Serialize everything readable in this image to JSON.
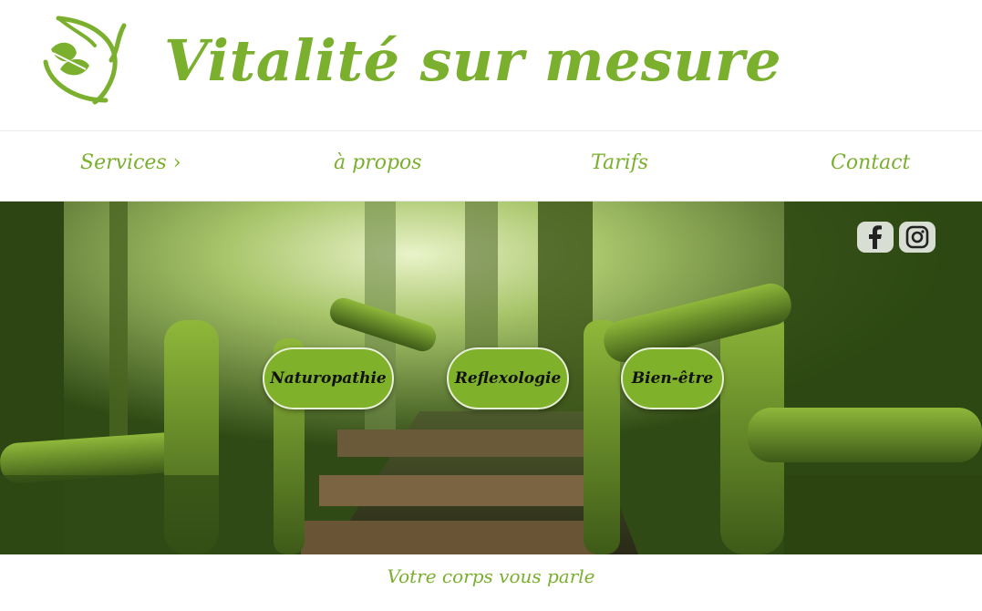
{
  "site": {
    "title": "Vitalité sur mesure",
    "brand_color": "#7ab02e"
  },
  "nav": {
    "items": [
      {
        "label": "Services",
        "has_submenu": true
      },
      {
        "label": "à propos"
      },
      {
        "label": "Tarifs"
      },
      {
        "label": "Contact"
      }
    ]
  },
  "social": {
    "icons": [
      "facebook-icon",
      "instagram-icon"
    ]
  },
  "hero": {
    "buttons": [
      {
        "label": "Naturopathie"
      },
      {
        "label": "Reflexologie"
      },
      {
        "label": "Bien-être"
      }
    ]
  },
  "tagline": "Votre corps vous parle"
}
